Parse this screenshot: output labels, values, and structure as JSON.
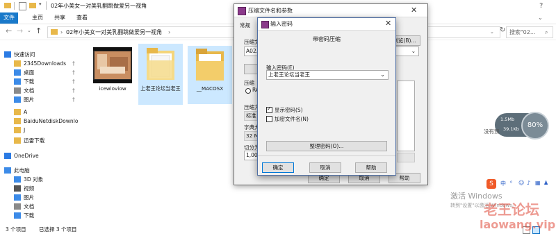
{
  "explorer": {
    "window_title": "02年小美女一对美乳翻跳做爱另一视角",
    "ribbon_tabs": [
      "文件",
      "主页",
      "共享",
      "查看"
    ],
    "address_path": "02年小美女一对美乳翻跳做爱另一视角",
    "search_placeholder": "搜索\"02...",
    "nav_items": [
      {
        "label": "快速访问",
        "icon": "star-icon",
        "pinned": false,
        "color": "#2b7be4"
      },
      {
        "label": "2345Downloads",
        "icon": "folder-icon",
        "pinned": true,
        "color": "#e8b84a"
      },
      {
        "label": "桌面",
        "icon": "desktop-icon",
        "pinned": true,
        "color": "#3c8be8"
      },
      {
        "label": "下载",
        "icon": "download-icon",
        "pinned": true,
        "color": "#3c8be8"
      },
      {
        "label": "文档",
        "icon": "document-icon",
        "pinned": true,
        "color": "#8a8a8a"
      },
      {
        "label": "图片",
        "icon": "picture-icon",
        "pinned": true,
        "color": "#3c8be8"
      },
      {
        "label": "A",
        "icon": "folder-icon",
        "pinned": false,
        "color": "#e8b84a"
      },
      {
        "label": "BaiduNetdiskDownlo",
        "icon": "folder-icon",
        "pinned": false,
        "color": "#e8b84a"
      },
      {
        "label": "J",
        "icon": "folder-icon",
        "pinned": false,
        "color": "#e8b84a"
      },
      {
        "label": "迅雷下载",
        "icon": "folder-icon",
        "pinned": false,
        "color": "#e8b84a"
      },
      {
        "label": "OneDrive",
        "icon": "cloud-icon",
        "pinned": false,
        "color": "#2b7be4"
      },
      {
        "label": "此电脑",
        "icon": "computer-icon",
        "pinned": false,
        "color": "#3c8be8"
      },
      {
        "label": "3D 对象",
        "icon": "cube-icon",
        "pinned": false,
        "color": "#3c8be8"
      },
      {
        "label": "视频",
        "icon": "video-icon",
        "pinned": false,
        "color": "#555555"
      },
      {
        "label": "图片",
        "icon": "picture-icon",
        "pinned": false,
        "color": "#3c8be8"
      },
      {
        "label": "文档",
        "icon": "document-icon",
        "pinned": false,
        "color": "#8a8a8a"
      },
      {
        "label": "下载",
        "icon": "download-icon",
        "pinned": false,
        "color": "#3c8be8"
      }
    ],
    "files": [
      {
        "name": "icewioviow",
        "type": "video",
        "selected": false
      },
      {
        "name": "上老王论坛当老王",
        "type": "document",
        "selected": true
      },
      {
        "name": "__MACOSX",
        "type": "folder",
        "selected": true
      }
    ],
    "status": {
      "count": "3 个项目",
      "selected": "已选择 3 个项目"
    }
  },
  "compress_dialog": {
    "title": "压缩文件名和参数",
    "tab_general": "常规",
    "label_archive_name": "压缩文",
    "archive_name_value": "A02.ra",
    "browse_button": "浏览(B)...",
    "label_update_mode": "压缩",
    "radio_rar": "RA",
    "label_method": "压缩方",
    "method_value": "标准",
    "label_dict": "字典大",
    "dict_value": "32 MB",
    "label_split": "切分为",
    "split_value": "1,000",
    "side_text": "没有预",
    "ok": "确定",
    "cancel": "取消",
    "help": "帮助"
  },
  "password_dialog": {
    "title": "输入密码",
    "heading": "带密码压缩",
    "label_enter": "输入密码(E)",
    "password_value": "上老王论坛当老王",
    "show_password": "显示密码(S)",
    "show_password_checked": true,
    "encrypt_names": "加密文件名(N)",
    "encrypt_names_checked": false,
    "organize_button": "整理密码(O)...",
    "ok": "确定",
    "cancel": "取消",
    "help": "帮助"
  },
  "overlays": {
    "net_up": "1.5Mb",
    "net_down": "39.1Kb",
    "cpu_percent": "80%",
    "activate_title": "激活 Windows",
    "activate_sub": "转到\"设置\"以激活 Windows。",
    "watermark_cn": "老王论坛",
    "watermark_url": "laowang.vip",
    "ime_label": "中"
  },
  "colors": {
    "accent": "#1979ca",
    "selection": "#cce8ff",
    "folder": "#e8b84a",
    "watermark": "#e04a3a"
  }
}
